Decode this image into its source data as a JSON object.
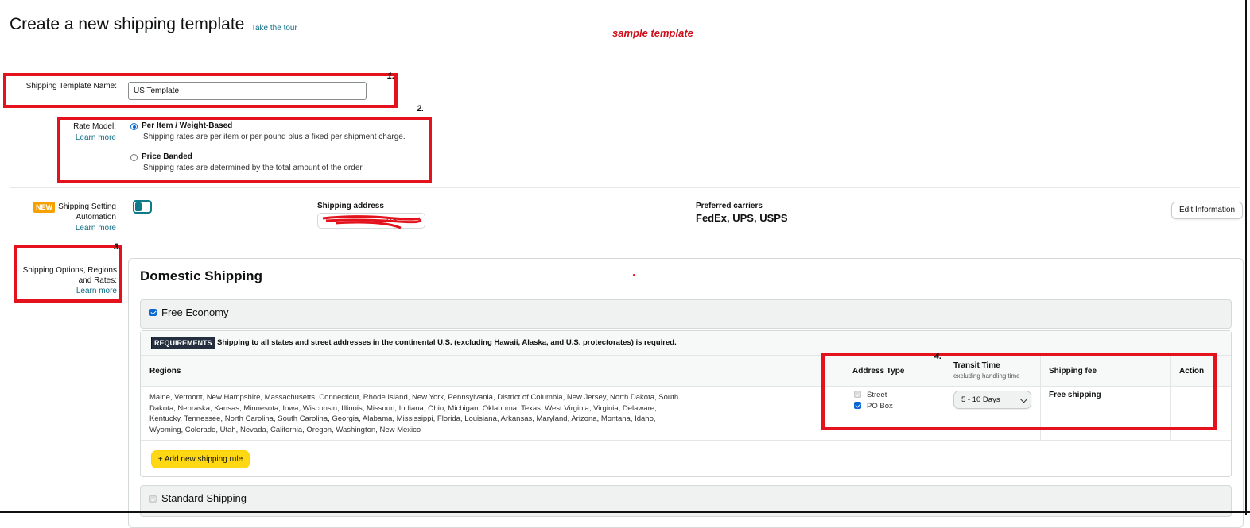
{
  "header": {
    "title": "Create a new shipping template",
    "tour_link": "Take the tour",
    "annotation": "sample template"
  },
  "annotations": {
    "n1": "1.",
    "n2": "2.",
    "n3": "3.",
    "n4": "4."
  },
  "template_name": {
    "label": "Shipping Template Name:",
    "value": "US Template"
  },
  "rate_model": {
    "label": "Rate Model:",
    "learn_more": "Learn more",
    "options": [
      {
        "title": "Per Item / Weight-Based",
        "desc": "Shipping rates are per item or per pound plus a fixed per shipment charge.",
        "selected": true
      },
      {
        "title": "Price Banded",
        "desc": "Shipping rates are determined by the total amount of the order.",
        "selected": false
      }
    ]
  },
  "automation": {
    "badge": "NEW",
    "label_line1": "Shipping Setting",
    "label_line2": "Automation",
    "learn_more": "Learn more",
    "shipping_address_label": "Shipping address",
    "shipping_address_value": "US",
    "preferred_carriers_label": "Preferred carriers",
    "preferred_carriers_value": "FedEx, UPS, USPS",
    "edit_button": "Edit Information"
  },
  "shipping_options": {
    "label_line1": "Shipping Options, Regions",
    "label_line2": "and Rates:",
    "learn_more": "Learn more"
  },
  "domestic": {
    "title": "Domestic Shipping",
    "free_economy": {
      "label": "Free Economy",
      "checked": true,
      "requirements_badge": "REQUIREMENTS",
      "requirements_text": "Shipping to all states and street addresses in the continental U.S. (excluding Hawaii, Alaska, and U.S. protectorates) is required.",
      "columns": {
        "regions": "Regions",
        "address_type": "Address Type",
        "transit_time": "Transit Time",
        "transit_sub": "excluding handling time",
        "shipping_fee": "Shipping fee",
        "action": "Action"
      },
      "row": {
        "regions_lines": [
          "Maine, Vermont, New Hampshire, Massachusetts, Connecticut, Rhode Island, New York, Pennsylvania, District of Columbia, New Jersey, North Dakota, South",
          "Dakota, Nebraska, Kansas, Minnesota, Iowa, Wisconsin, Illinois, Missouri, Indiana, Ohio, Michigan, Oklahoma, Texas, West Virginia, Virginia, Delaware,",
          "Kentucky, Tennessee, North Carolina, South Carolina, Georgia, Alabama, Mississippi, Florida, Louisiana, Arkansas, Maryland, Arizona, Montana, Idaho,",
          "Wyoming, Colorado, Utah, Nevada, California, Oregon, Washington, New Mexico"
        ],
        "address_street": "Street",
        "address_pobox": "PO Box",
        "transit_value": "5 - 10 Days",
        "fee": "Free shipping"
      },
      "add_rule_button": "+ Add new shipping rule"
    },
    "standard": {
      "label": "Standard Shipping"
    }
  }
}
